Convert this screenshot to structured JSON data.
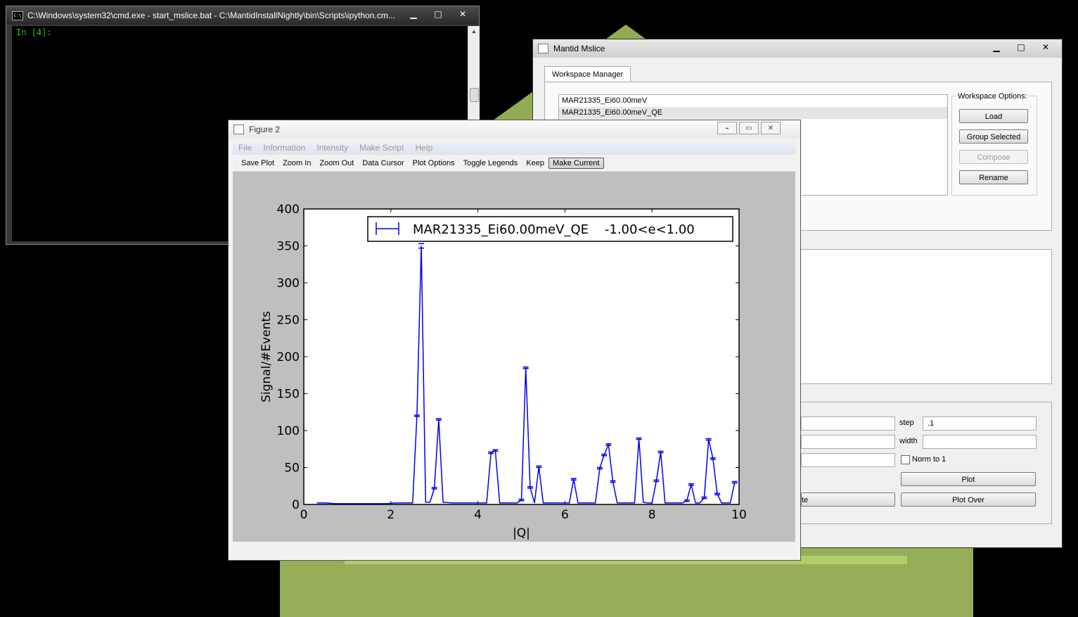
{
  "cmd": {
    "title": "C:\\Windows\\system32\\cmd.exe - start_mslice.bat - C:\\MantidInstallNightly\\bin\\Scripts\\ipython.cm...",
    "icon_text": "C:\\",
    "prompt": "In [4]:"
  },
  "mslice": {
    "title": "Mantid Mslice",
    "tab": "Workspace Manager",
    "workspaces": [
      "MAR21335_Ei60.00meV",
      "MAR21335_Ei60.00meV_QE"
    ],
    "options_label": "Workspace Options:",
    "buttons": {
      "load": "Load",
      "group": "Group Selected",
      "compose": "Compose",
      "rename": "Rename"
    },
    "cut": {
      "step_label": "step",
      "step_value": ".1",
      "width_label": "width",
      "width_value": "",
      "norm_label": "Norm to 1",
      "plot": "Plot",
      "plot_over": "Plot Over",
      "partial_button": "te"
    }
  },
  "figure": {
    "title": "Figure 2",
    "menu": [
      "File",
      "Information",
      "Intensity",
      "Make Script",
      "Help"
    ],
    "toolbar": [
      "Save Plot",
      "Zoom In",
      "Zoom Out",
      "Data Cursor",
      "Plot Options",
      "Toggle Legends",
      "Keep",
      "Make Current"
    ]
  },
  "colors": {
    "line": "#0000ee",
    "plot_bg": "#bfbfbf",
    "console_text": "#19c919"
  },
  "icons": {
    "minimize": "minimize-icon",
    "maximize": "maximize-icon",
    "close": "close-icon"
  },
  "chart_data": {
    "type": "line",
    "xlabel": "|Q|",
    "ylabel": "Signal/#Events",
    "xlim": [
      0,
      10
    ],
    "ylim": [
      0,
      400
    ],
    "xticks": [
      "0",
      "2",
      "4",
      "6",
      "8",
      "10"
    ],
    "yticks": [
      "0",
      "50",
      "100",
      "150",
      "200",
      "250",
      "300",
      "350",
      "400"
    ],
    "legend": "top-right",
    "series": [
      {
        "name": "MAR21335_Ei60.00meV_QE    -1.00<e<1.00",
        "x": [
          0.3,
          0.5,
          0.7,
          0.9,
          1.1,
          1.3,
          1.5,
          1.7,
          1.9,
          2.1,
          2.3,
          2.5,
          2.6,
          2.7,
          2.8,
          2.9,
          3.0,
          3.1,
          3.2,
          3.4,
          3.6,
          3.8,
          4.0,
          4.2,
          4.3,
          4.4,
          4.5,
          4.7,
          4.9,
          5.0,
          5.1,
          5.2,
          5.3,
          5.4,
          5.5,
          5.7,
          5.9,
          6.1,
          6.2,
          6.3,
          6.5,
          6.7,
          6.8,
          6.9,
          7.0,
          7.1,
          7.2,
          7.4,
          7.6,
          7.7,
          7.8,
          7.9,
          8.0,
          8.1,
          8.2,
          8.3,
          8.5,
          8.7,
          8.8,
          8.9,
          9.0,
          9.1,
          9.2,
          9.3,
          9.4,
          9.5,
          9.6,
          9.7,
          9.8,
          9.9
        ],
        "y": [
          2,
          2,
          1,
          1,
          1,
          1,
          1,
          1,
          1,
          2,
          2,
          2,
          120,
          350,
          3,
          3,
          22,
          115,
          3,
          2,
          2,
          2,
          2,
          2,
          70,
          73,
          2,
          2,
          2,
          6,
          185,
          23,
          2,
          51,
          2,
          2,
          2,
          2,
          34,
          2,
          2,
          2,
          49,
          67,
          81,
          31,
          2,
          2,
          2,
          89,
          3,
          2,
          2,
          32,
          71,
          2,
          2,
          2,
          5,
          27,
          2,
          2,
          9,
          88,
          62,
          14,
          2,
          2,
          2,
          30
        ],
        "err": [
          0,
          0,
          0,
          0,
          0,
          0,
          0,
          0,
          0,
          0,
          0,
          0,
          1,
          3,
          1,
          1,
          1,
          1,
          1,
          0,
          0,
          0,
          0,
          0,
          1,
          1,
          0,
          0,
          0,
          1,
          1,
          1,
          0,
          1,
          0,
          0,
          0,
          0,
          1,
          0,
          0,
          0,
          1,
          1,
          1,
          1,
          0,
          0,
          0,
          1,
          1,
          0,
          0,
          1,
          1,
          0,
          0,
          0,
          1,
          1,
          0,
          0,
          1,
          1,
          1,
          1,
          0,
          0,
          0,
          1
        ]
      }
    ]
  }
}
